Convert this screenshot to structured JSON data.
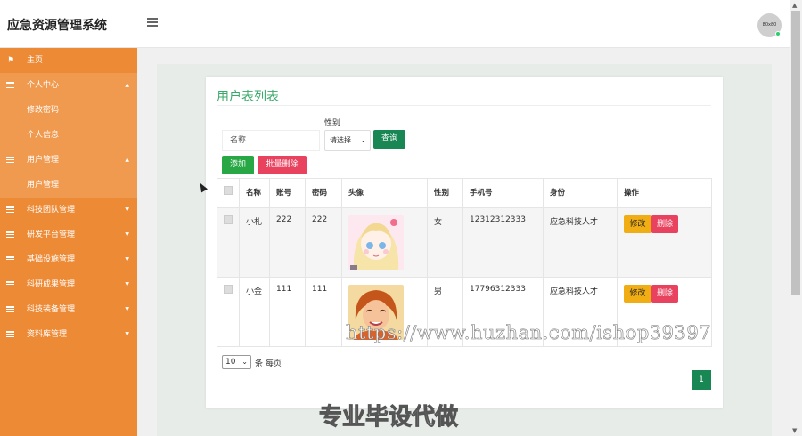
{
  "app": {
    "title": "应急资源管理系统",
    "avatar_text": "80x80"
  },
  "sidebar": {
    "home": "主页",
    "personal_center": "个人中心",
    "change_password": "修改密码",
    "personal_info": "个人信息",
    "user_management": "用户管理",
    "user_management_sub": "用户管理",
    "items": [
      "科技团队管理",
      "研发平台管理",
      "基础设施管理",
      "科研成果管理",
      "科技装备管理",
      "资料库管理"
    ]
  },
  "page": {
    "title": "用户表列表",
    "search": {
      "name_placeholder": "名称",
      "gender_label": "性别",
      "gender_select": "请选择",
      "query_button": "查询"
    },
    "actions": {
      "add": "添加",
      "batch_delete": "批量删除"
    },
    "table": {
      "headers": [
        "名称",
        "账号",
        "密码",
        "头像",
        "性别",
        "手机号",
        "身份",
        "操作"
      ],
      "rows": [
        {
          "name": "小札",
          "account": "222",
          "password": "222",
          "gender": "女",
          "phone": "12312312333",
          "identity": "应急科技人才"
        },
        {
          "name": "小金",
          "account": "111",
          "password": "111",
          "gender": "男",
          "phone": "17796312333",
          "identity": "应急科技人才"
        }
      ],
      "edit_label": "修改",
      "delete_label": "删除"
    },
    "pagination": {
      "page_size": "10",
      "per_page_text": "条 每页",
      "current_page": "1"
    }
  },
  "watermark": {
    "url": "https://www.huzhan.com/ishop39397",
    "slogan": "专业毕设代做"
  },
  "colors": {
    "sidebar": "#ed8a35",
    "accent": "#198754",
    "danger": "#e8425e",
    "warning": "#f0ad14"
  }
}
